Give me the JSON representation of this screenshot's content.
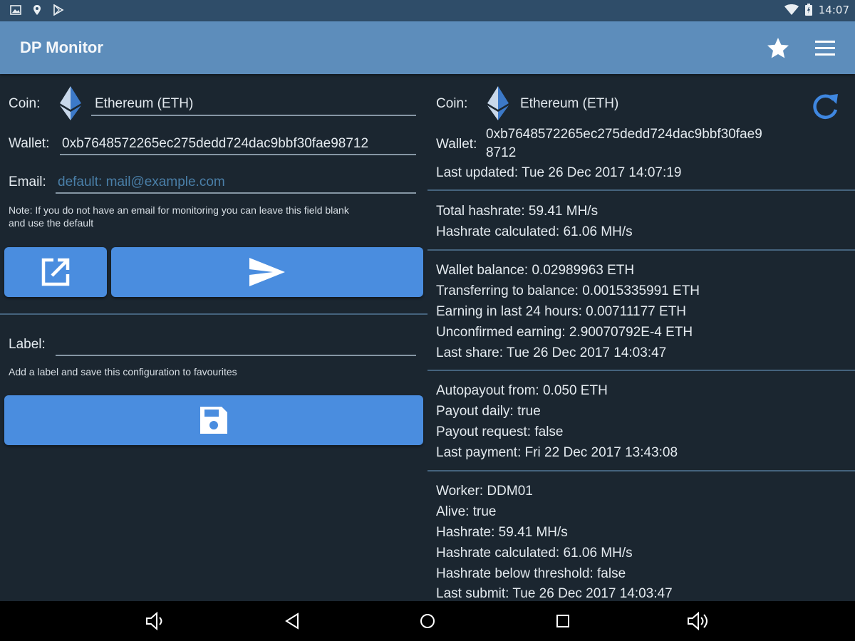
{
  "status_bar": {
    "time": "14:07",
    "left_icons": [
      "image-icon",
      "location-icon",
      "play-store-icon"
    ],
    "right_icons": [
      "wifi-icon",
      "battery-icon"
    ]
  },
  "app_bar": {
    "title": "DP Monitor",
    "icons": [
      "star-icon",
      "menu-icon"
    ]
  },
  "form": {
    "coin_label": "Coin:",
    "coin_value": "Ethereum (ETH)",
    "wallet_label": "Wallet:",
    "wallet_value": "0xb7648572265ec275dedd724dac9bbf30fae98712",
    "email_label": "Email:",
    "email_placeholder": "default: mail@example.com",
    "email_note_line1": "Note: If you do not have an email for monitoring you can leave this field blank",
    "email_note_line2": "and use the default",
    "open_button_icon": "open-external-icon",
    "send_button_icon": "send-icon",
    "label_label": "Label:",
    "label_note": "Add a label and save this configuration to favourites",
    "save_button_icon": "save-icon"
  },
  "summary": {
    "coin_label": "Coin:",
    "coin_value": "Ethereum (ETH)",
    "refresh_icon": "refresh-icon",
    "wallet_label": "Wallet:",
    "wallet_line1": "0xb7648572265ec275dedd724dac9bbf30fae9",
    "wallet_line2": "8712",
    "last_updated": "Last updated: Tue 26 Dec 2017 14:07:19",
    "hashrate_section": [
      "Total hashrate: 59.41 MH/s",
      "Hashrate calculated: 61.06 MH/s"
    ],
    "balance_section": [
      "Wallet balance: 0.02989963 ETH",
      "Transferring to balance: 0.0015335991 ETH",
      "Earning in last 24 hours: 0.00711177 ETH",
      "Unconfirmed earning: 2.90070792E-4 ETH",
      "Last share: Tue 26 Dec 2017 14:03:47"
    ],
    "payout_section": [
      "Autopayout from: 0.050 ETH",
      "Payout daily: true",
      "Payout request: false",
      "Last payment: Fri 22 Dec 2017 13:43:08"
    ],
    "worker_section": [
      "Worker: DDM01",
      "Alive: true",
      "Hashrate: 59.41 MH/s",
      "Hashrate calculated: 61.06 MH/s",
      "Hashrate below threshold: false",
      "Last submit: Tue 26 Dec 2017 14:03:47"
    ]
  },
  "nav_bar": {
    "icons": [
      "volume-down-icon",
      "back-icon",
      "home-icon",
      "recents-icon",
      "volume-up-icon"
    ]
  },
  "colors": {
    "status_bar": "#2f4d69",
    "app_bar": "#5d8dbb",
    "background": "#1b2630",
    "button": "#4a8ddf",
    "accent_blue": "#3f87e0"
  }
}
